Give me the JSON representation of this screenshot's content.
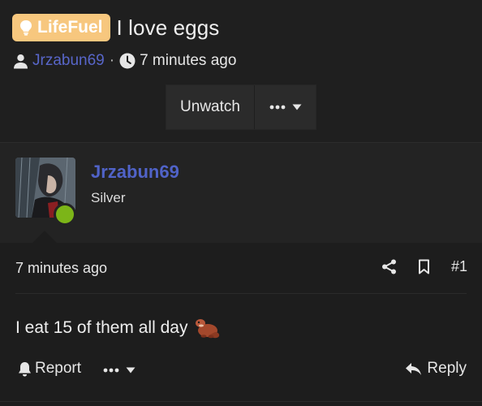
{
  "thread": {
    "prefix": "LifeFuel",
    "title": "I love eggs",
    "author": "Jrzabun69",
    "separator": "·",
    "time": "7 minutes ago",
    "unwatch_label": "Unwatch"
  },
  "post": {
    "username": "Jrzabun69",
    "user_title": "Silver",
    "time": "7 minutes ago",
    "number": "#1",
    "message": "I eat 15 of them all day",
    "report_label": "Report",
    "reply_label": "Reply"
  },
  "colors": {
    "prefix_bg": "#f7c77e",
    "username": "#5063c8",
    "online": "#7cb518"
  }
}
